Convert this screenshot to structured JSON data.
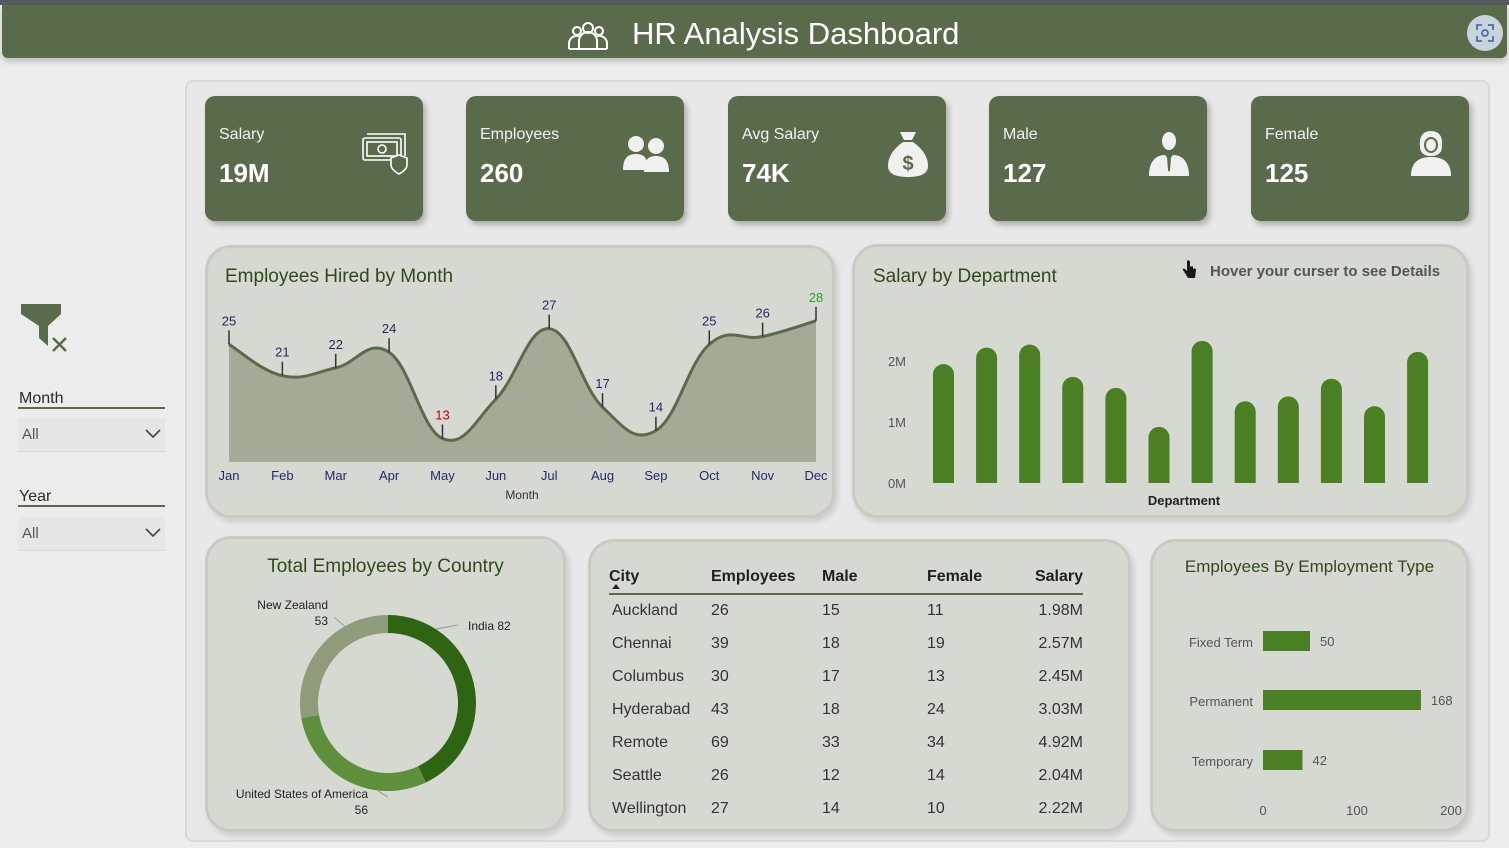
{
  "header": {
    "title": "HR Analysis Dashboard"
  },
  "sidebar": {
    "month": {
      "label": "Month",
      "value": "All"
    },
    "year": {
      "label": "Year",
      "value": "All"
    }
  },
  "kpis": [
    {
      "label": "Salary",
      "value": "19M",
      "icon": "money-shield-icon"
    },
    {
      "label": "Employees",
      "value": "260",
      "icon": "users-icon"
    },
    {
      "label": "Avg Salary",
      "value": "74K",
      "icon": "money-bag-icon"
    },
    {
      "label": "Male",
      "value": "127",
      "icon": "male-icon"
    },
    {
      "label": "Female",
      "value": "125",
      "icon": "female-icon"
    }
  ],
  "colors": {
    "header": "#5a6b4c",
    "bar": "#4a7f24",
    "area": "#a3aa96",
    "line": "#5a6b4c",
    "min_label": "#c00000",
    "max_label": "#2e9a2e"
  },
  "hired_chart": {
    "title": "Employees Hired by Month",
    "xlabel": "Month"
  },
  "salary_chart": {
    "title": "Salary by Department",
    "hint": "Hover your curser to see Details",
    "xlabel": "Department"
  },
  "country_chart": {
    "title": "Total Employees by Country"
  },
  "employment_chart": {
    "title": "Employees By Employment Type"
  },
  "city_table": {
    "columns": [
      "City",
      "Employees",
      "Male",
      "Female",
      "Salary"
    ],
    "rows": [
      [
        "Auckland",
        "26",
        "15",
        "11",
        "1.98M"
      ],
      [
        "Chennai",
        "39",
        "18",
        "19",
        "2.57M"
      ],
      [
        "Columbus",
        "30",
        "17",
        "13",
        "2.45M"
      ],
      [
        "Hyderabad",
        "43",
        "18",
        "24",
        "3.03M"
      ],
      [
        "Remote",
        "69",
        "33",
        "34",
        "4.92M"
      ],
      [
        "Seattle",
        "26",
        "12",
        "14",
        "2.04M"
      ],
      [
        "Wellington",
        "27",
        "14",
        "10",
        "2.22M"
      ]
    ]
  },
  "chart_data": [
    {
      "type": "area",
      "title": "Employees Hired by Month",
      "xlabel": "Month",
      "ylabel": "",
      "categories": [
        "Jan",
        "Feb",
        "Mar",
        "Apr",
        "May",
        "Jun",
        "Jul",
        "Aug",
        "Sep",
        "Oct",
        "Nov",
        "Dec"
      ],
      "values": [
        25,
        21,
        22,
        24,
        13,
        18,
        27,
        17,
        14,
        25,
        26,
        28
      ],
      "data_labels": true,
      "grid": false
    },
    {
      "type": "bar",
      "title": "Salary by Department",
      "xlabel": "Department",
      "ylabel": "",
      "y_ticks": [
        "0M",
        "1M",
        "2M"
      ],
      "ylim": [
        0,
        2.5
      ],
      "values": [
        1.95,
        2.22,
        2.27,
        1.74,
        1.56,
        0.92,
        2.33,
        1.34,
        1.42,
        1.71,
        1.26,
        2.15
      ],
      "grid": false
    },
    {
      "type": "pie",
      "title": "Total Employees by Country",
      "donut": true,
      "slices": [
        {
          "label": "India",
          "value": 82,
          "color": "#2f6413"
        },
        {
          "label": "United States of America",
          "value": 56,
          "color": "#5e8f3a"
        },
        {
          "label": "New Zealand",
          "value": 53,
          "color": "#8e9c7c"
        }
      ]
    },
    {
      "type": "bar",
      "orientation": "horizontal",
      "title": "Employees By Employment Type",
      "categories": [
        "Fixed Term",
        "Permanent",
        "Temporary"
      ],
      "values": [
        50,
        168,
        42
      ],
      "xlim": [
        0,
        200
      ],
      "x_ticks": [
        "0",
        "100",
        "200"
      ],
      "grid": false
    }
  ]
}
